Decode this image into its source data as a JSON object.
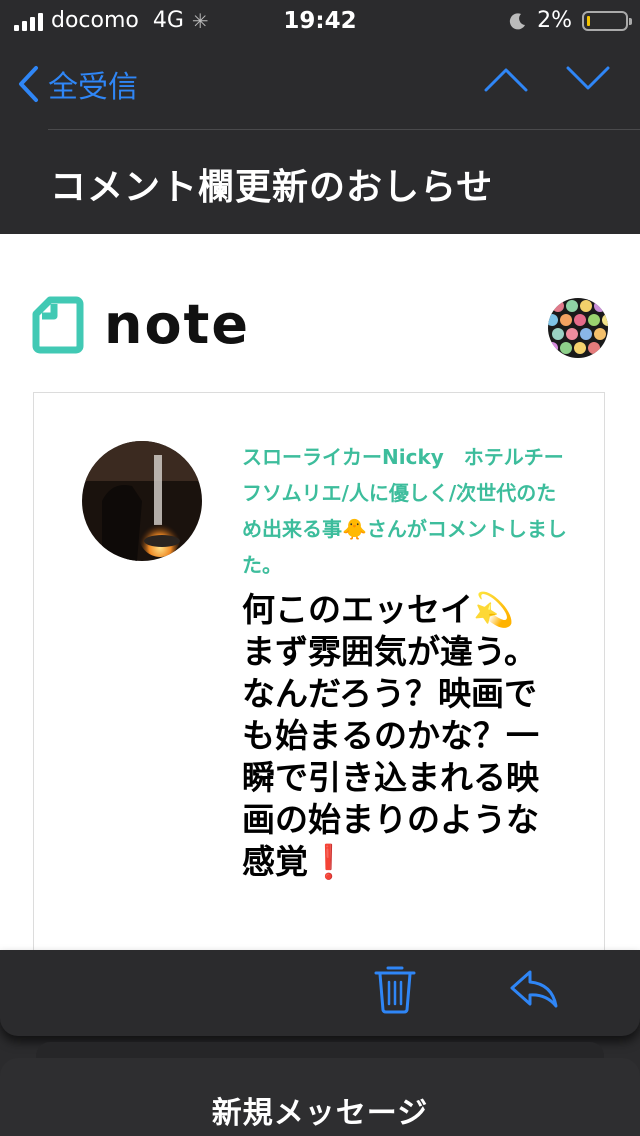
{
  "status_bar": {
    "carrier": "docomo",
    "network": "4G",
    "time": "19:42",
    "battery": "2%"
  },
  "nav": {
    "back_label": "全受信"
  },
  "email": {
    "subject": "コメント欄更新のおしらせ",
    "brand": "note",
    "notice": "スローライカーNicky　ホテルチーフソムリエ/人に優しく/次世代のため出来る事🐥さんがコメントしました。",
    "comment": "何このエッセイ💫まず雰囲気が違う。なんだろう？映画でも始まるのかな？一瞬で引き込まれる映画の始まりのような感覚❗"
  },
  "compose": {
    "title": "新規メッセージ"
  },
  "colors": {
    "accent": "#2f86f6",
    "note_green": "#3dbd9c",
    "dark_bg": "#2b2b2d"
  },
  "icons": [
    "signal-icon",
    "activity-spinner-icon",
    "moon-icon",
    "battery-icon",
    "chevron-left-icon",
    "chevron-up-icon",
    "chevron-down-icon",
    "note-logo-icon",
    "trash-icon",
    "reply-icon"
  ]
}
